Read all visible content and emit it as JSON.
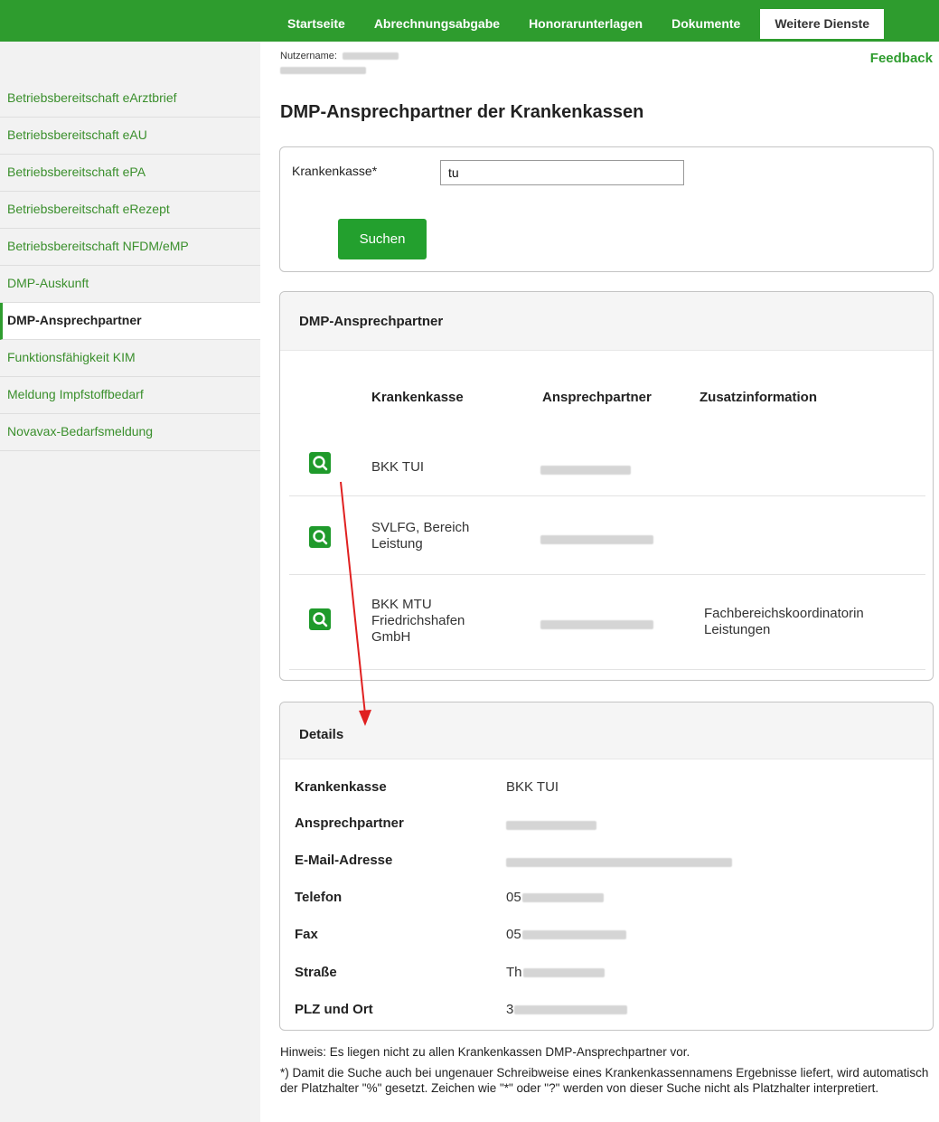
{
  "topnav": {
    "tabs": [
      {
        "label": "Startseite"
      },
      {
        "label": "Abrechnungsabgabe"
      },
      {
        "label": "Honorarunterlagen"
      },
      {
        "label": "Dokumente"
      },
      {
        "label": "Weitere Dienste",
        "active": true
      }
    ]
  },
  "header": {
    "username_label": "Nutzername:",
    "feedback_label": "Feedback"
  },
  "sidebar": {
    "items": [
      {
        "label": "Betriebsbereitschaft eArztbrief"
      },
      {
        "label": "Betriebsbereitschaft eAU"
      },
      {
        "label": "Betriebsbereitschaft ePA"
      },
      {
        "label": "Betriebsbereitschaft eRezept"
      },
      {
        "label": "Betriebsbereitschaft NFDM/eMP"
      },
      {
        "label": "DMP-Auskunft"
      },
      {
        "label": "DMP-Ansprechpartner",
        "active": true
      },
      {
        "label": "Funktionsfähigkeit KIM"
      },
      {
        "label": "Meldung Impfstoffbedarf"
      },
      {
        "label": "Novavax-Bedarfsmeldung"
      }
    ]
  },
  "main": {
    "title": "DMP-Ansprechpartner der Krankenkassen",
    "search": {
      "label": "Krankenkasse*",
      "value": "tu",
      "button_label": "Suchen"
    },
    "results": {
      "heading": "DMP-Ansprechpartner",
      "columns": [
        "Krankenkasse",
        "Ansprechpartner",
        "Zusatzinformation"
      ],
      "rows": [
        {
          "kasse_lines": [
            "BKK TUI"
          ],
          "zusatz_lines": []
        },
        {
          "kasse_lines": [
            "SVLFG, Bereich",
            "Leistung"
          ],
          "zusatz_lines": []
        },
        {
          "kasse_lines": [
            "BKK MTU",
            "Friedrichshafen",
            "GmbH"
          ],
          "zusatz_lines": [
            "Fachbereichskoordinatorin",
            "Leistungen"
          ]
        }
      ]
    },
    "details": {
      "heading": "Details",
      "fields": [
        {
          "label": "Krankenkasse",
          "value": "BKK TUI"
        },
        {
          "label": "Ansprechpartner",
          "value": ""
        },
        {
          "label": "E-Mail-Adresse",
          "value": ""
        },
        {
          "label": "Telefon",
          "value": "05"
        },
        {
          "label": "Fax",
          "value": "05"
        },
        {
          "label": "Straße",
          "value": "Th"
        },
        {
          "label": "PLZ und Ort",
          "value": "3"
        }
      ]
    },
    "notes": [
      "Hinweis: Es liegen nicht zu allen Krankenkassen DMP-Ansprechpartner vor.",
      "*) Damit die Suche auch bei ungenauer Schreibweise eines Krankenkassennamens Ergebnisse liefert, wird automatisch der Platzhalter \"%\" gesetzt. Zeichen wie \"*\" oder \"?\" werden von dieser Suche nicht als Platzhalter interpretiert."
    ]
  },
  "colors": {
    "brand_green": "#2e9c2e",
    "button_green": "#23a02e",
    "link_green": "#3a8f2c",
    "annotation_arrow": "#e02020"
  }
}
